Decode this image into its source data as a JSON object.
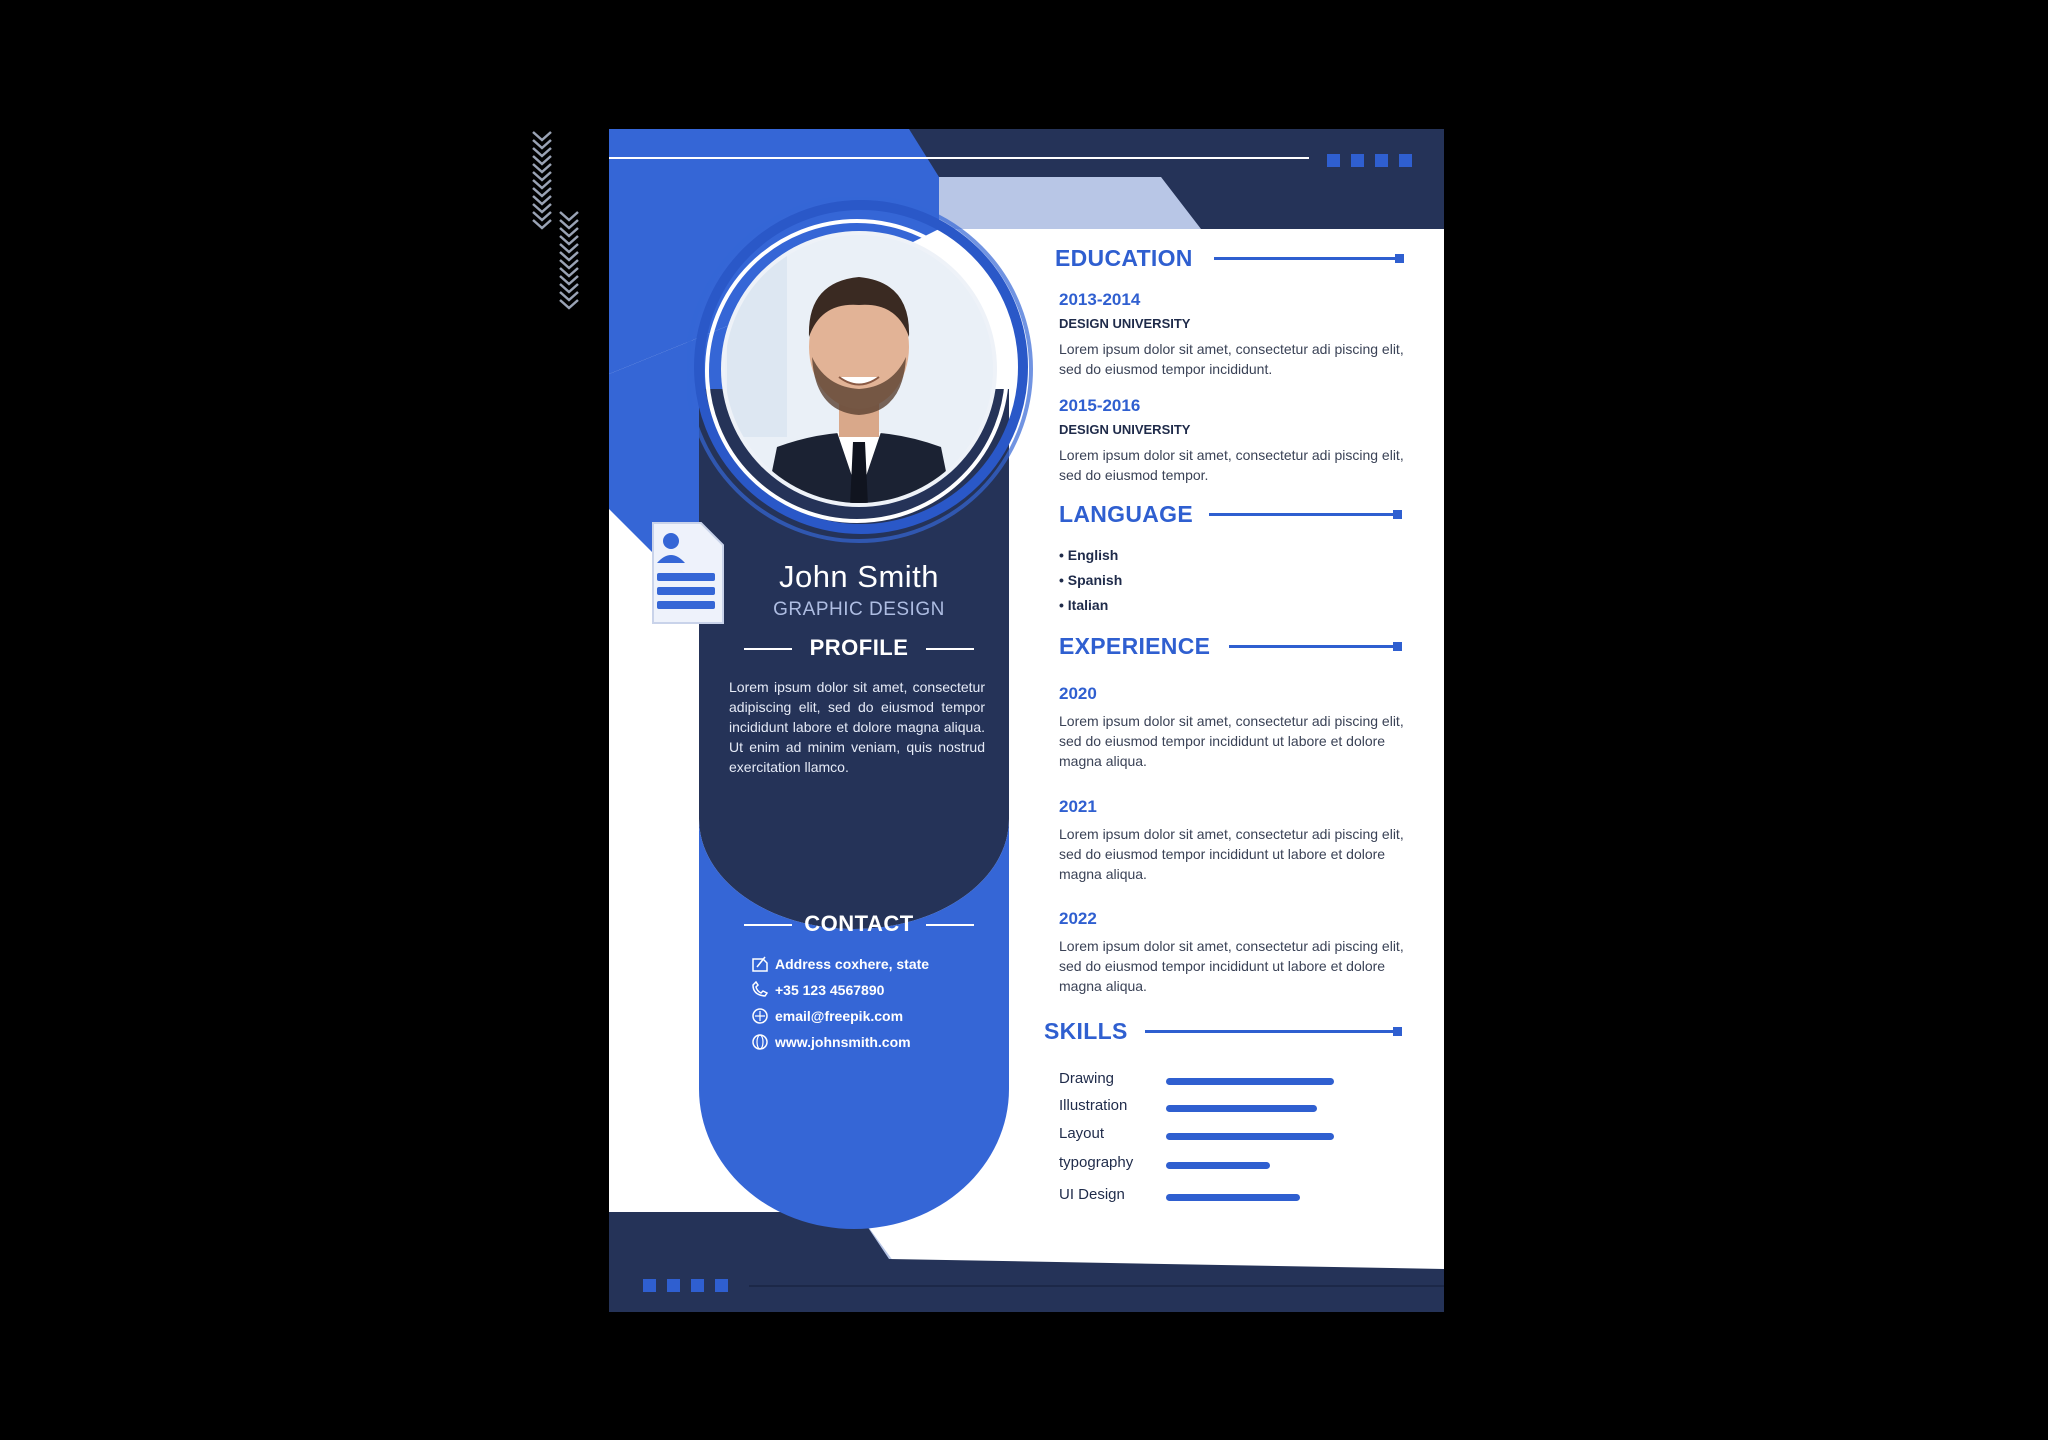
{
  "colors": {
    "background": "#000000",
    "navy": "#253358",
    "blue": "#2f5fd0",
    "light_blue": "#b8c6e6",
    "white": "#ffffff"
  },
  "profile": {
    "name": "John Smith",
    "role": "GRAPHIC DESIGN",
    "heading": "PROFILE",
    "text": "Lorem ipsum dolor sit amet, consectetur adipiscing elit, sed do eiusmod tempor incididunt labore et dolore magna aliqua. Ut enim ad minim veniam, quis nostrud exercitation llamco."
  },
  "contact": {
    "heading": "CONTACT",
    "items": [
      {
        "icon": "location-icon",
        "text": "Address coxhere, state"
      },
      {
        "icon": "phone-icon",
        "text": "+35 123 4567890"
      },
      {
        "icon": "email-icon",
        "text": "email@freepik.com"
      },
      {
        "icon": "globe-icon",
        "text": "www.johnsmith.com"
      }
    ]
  },
  "education": {
    "heading": "EDUCATION",
    "entries": [
      {
        "year": "2013-2014",
        "school": "DESIGN UNIVERSITY",
        "text": "Lorem ipsum dolor sit amet, consectetur adi piscing elit, sed do eiusmod tempor incididunt."
      },
      {
        "year": "2015-2016",
        "school": "DESIGN UNIVERSITY",
        "text": "Lorem ipsum dolor sit amet, consectetur adi piscing elit, sed do eiusmod tempor."
      }
    ]
  },
  "language": {
    "heading": "LANGUAGE",
    "items": [
      "• English",
      "• Spanish",
      "• Italian"
    ]
  },
  "experience": {
    "heading": "EXPERIENCE",
    "entries": [
      {
        "year": "2020",
        "text": "Lorem ipsum dolor sit amet, consectetur adi piscing elit, sed do eiusmod tempor incididunt ut labore et dolore magna aliqua."
      },
      {
        "year": "2021",
        "text": "Lorem ipsum dolor sit amet, consectetur adi piscing elit, sed do eiusmod tempor incididunt ut labore et dolore magna aliqua."
      },
      {
        "year": "2022",
        "text": "Lorem ipsum dolor sit amet, consectetur adi piscing elit, sed do eiusmod tempor incididunt ut labore et dolore magna aliqua."
      }
    ]
  },
  "skills": {
    "heading": "SKILLS",
    "items": [
      {
        "name": "Drawing",
        "level": 1.0
      },
      {
        "name": "Illustration",
        "level": 0.9
      },
      {
        "name": "Layout",
        "level": 1.0
      },
      {
        "name": "typography",
        "level": 0.62
      },
      {
        "name": "UI Design",
        "level": 0.8
      }
    ]
  }
}
